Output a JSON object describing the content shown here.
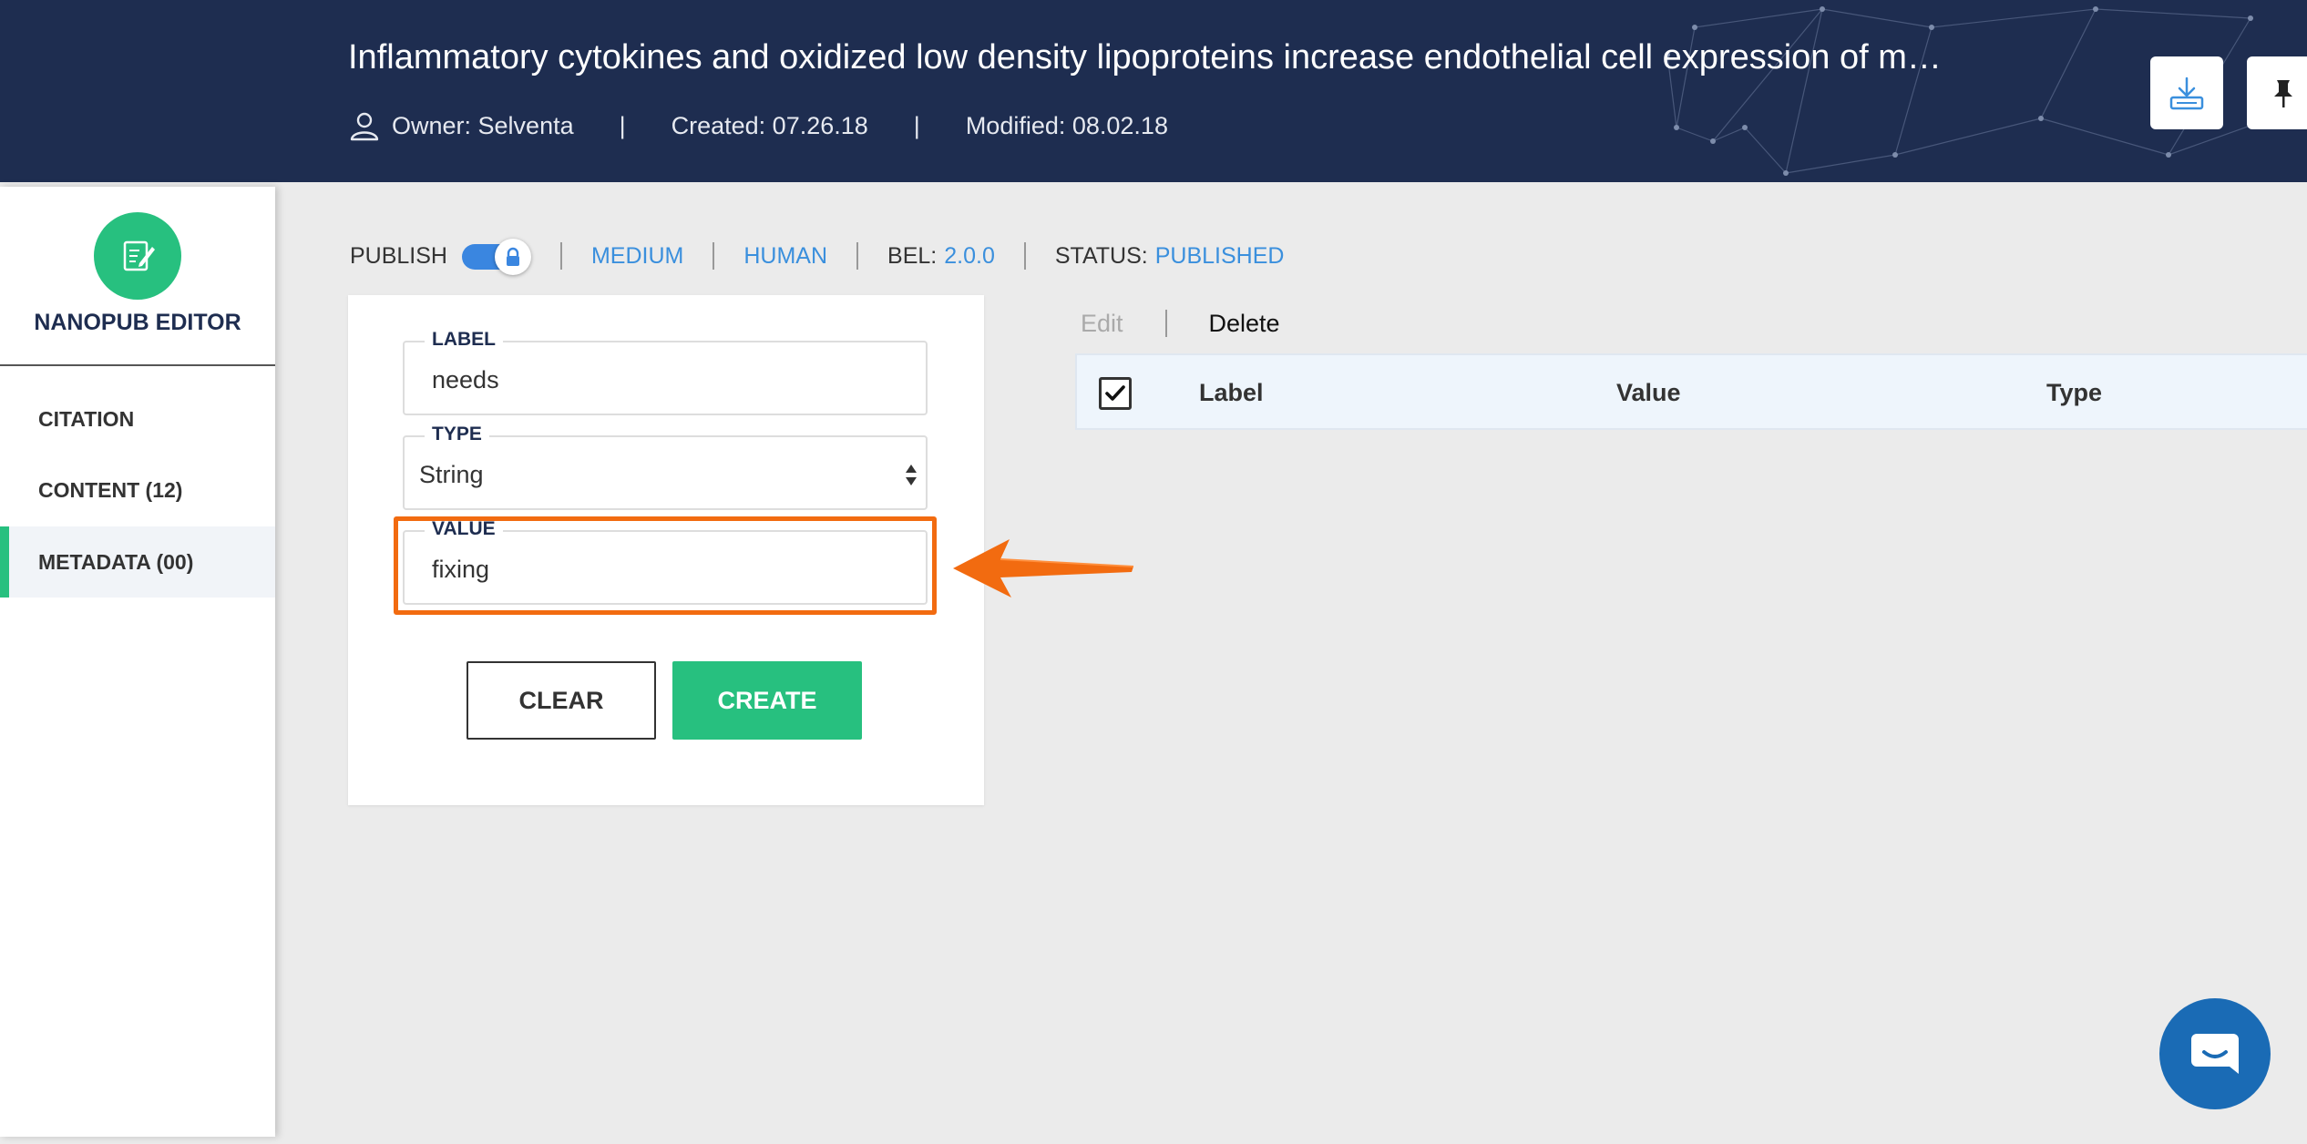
{
  "header": {
    "title": "Inflammatory cytokines and oxidized low density lipoproteins increase endothelial cell expression of m…",
    "owner": "Owner: Selventa",
    "separator": "|",
    "created": "Created: 07.26.18",
    "modified": "Modified: 08.02.18",
    "background_color": "#1e2d50"
  },
  "sidebar": {
    "title": "NANOPUB EDITOR",
    "items": [
      {
        "label": "CITATION",
        "active": false
      },
      {
        "label": "CONTENT (12)",
        "active": false
      },
      {
        "label": "METADATA (00)",
        "active": true
      }
    ],
    "accent_color": "#27c07f"
  },
  "toolbar": {
    "publish_label": "PUBLISH",
    "publish_on": true,
    "medium": "MEDIUM",
    "human": "HUMAN",
    "bel_label": "BEL:",
    "bel_version": "2.0.0",
    "status_label": "STATUS:",
    "status_value": "PUBLISHED",
    "link_color": "#3a8fdd"
  },
  "form": {
    "label_legend": "LABEL",
    "label_value": "needs",
    "type_legend": "TYPE",
    "type_value": "String",
    "value_legend": "VALUE",
    "value_value": "fixing",
    "clear_label": "CLEAR",
    "create_label": "CREATE",
    "highlight_color": "#f26b10"
  },
  "table": {
    "edit_label": "Edit",
    "separator": "|",
    "delete_label": "Delete",
    "columns": [
      "Label",
      "Value",
      "Type"
    ],
    "select_all_checked": true
  },
  "icons": {
    "owner": "user-icon",
    "logo": "edit-document-icon",
    "download": "download-icon",
    "pin": "pin-icon",
    "lock": "lock-icon",
    "chat": "chat-icon"
  }
}
